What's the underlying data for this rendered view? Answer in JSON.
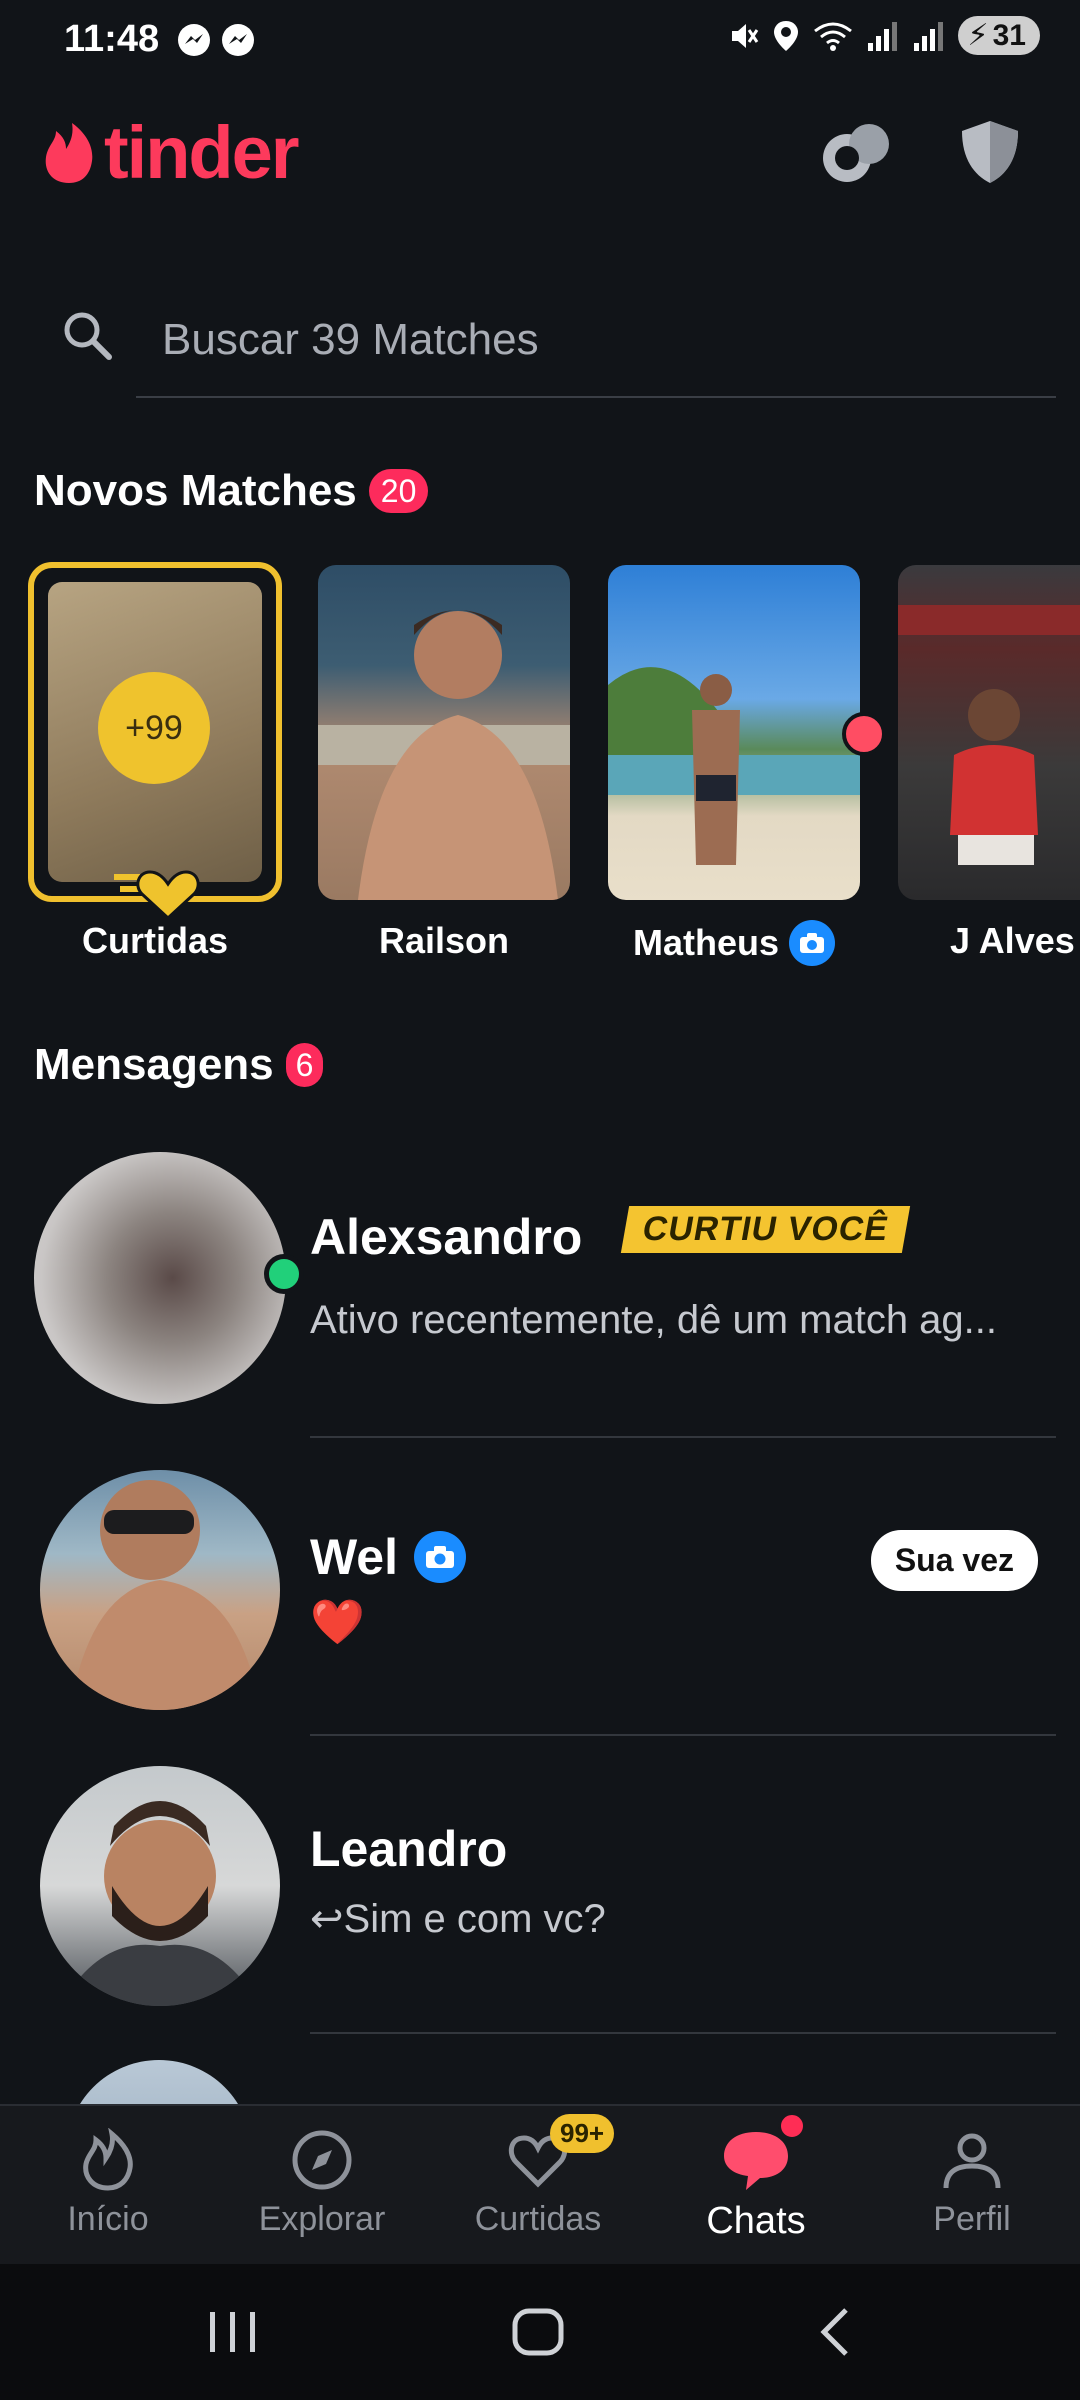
{
  "status": {
    "time": "11:48",
    "battery": "31"
  },
  "header": {
    "logo_text": "tinder"
  },
  "search": {
    "placeholder": "Buscar 39 Matches"
  },
  "new_matches": {
    "title": "Novos Matches",
    "count": "20",
    "items": [
      {
        "name": "Curtidas",
        "badge": "+99"
      },
      {
        "name": "Railson"
      },
      {
        "name": "Matheus"
      },
      {
        "name": "J Alves"
      }
    ]
  },
  "messages": {
    "title": "Mensagens",
    "count": "6",
    "items": [
      {
        "name": "Alexsandro",
        "tag": "CURTIU VOCÊ",
        "preview": "Ativo recentemente, dê um match ag..."
      },
      {
        "name": "Wel",
        "preview": "❤️",
        "action": "Sua vez"
      },
      {
        "name": "Leandro",
        "preview": "↩Sim e com vc?"
      }
    ]
  },
  "nav": {
    "items": [
      {
        "label": "Início"
      },
      {
        "label": "Explorar"
      },
      {
        "label": "Curtidas",
        "badge": "99+"
      },
      {
        "label": "Chats"
      },
      {
        "label": "Perfil"
      }
    ]
  },
  "colors": {
    "brand": "#fd3a5c",
    "gold": "#f4c430",
    "background": "#111418"
  }
}
